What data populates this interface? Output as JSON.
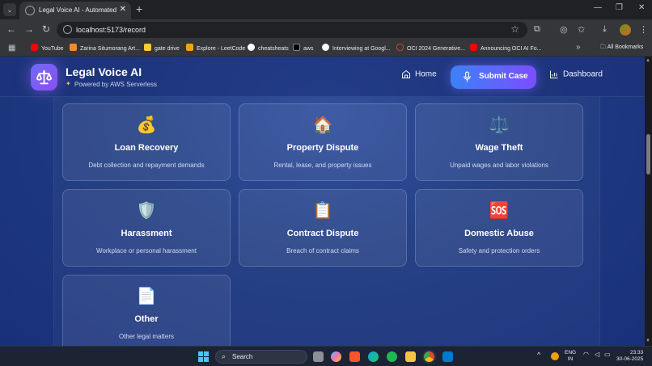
{
  "browser": {
    "tab_title": "Legal Voice AI - Automated Legal",
    "url": "localhost:5173/record",
    "bookmarks": [
      {
        "label": "YouTube",
        "color": "#ff0000"
      },
      {
        "label": "Zarina Situmorang Art...",
        "color": "#f28c28"
      },
      {
        "label": "gate drive",
        "color": "#ffcc33"
      },
      {
        "label": "Explore - LeetCode",
        "color": "#f89f1b"
      },
      {
        "label": "cheatsheats",
        "color": "#ffffff"
      },
      {
        "label": "aws",
        "color": "#232f3e"
      },
      {
        "label": "Interviewing at Googl...",
        "color": "#ffffff"
      },
      {
        "label": "OCI 2024 Generative...",
        "color": "#c74634"
      },
      {
        "label": "Announcing OCI AI Fo...",
        "color": "#ff0000"
      }
    ],
    "all_bookmarks_label": "All Bookmarks"
  },
  "app": {
    "title": "Legal Voice AI",
    "subtitle": "Powered by AWS Serverless",
    "nav": {
      "home": "Home",
      "submit_case": "Submit Case",
      "dashboard": "Dashboard"
    }
  },
  "categories": [
    {
      "title": "Loan Recovery",
      "description": "Debt collection and repayment demands",
      "icon": "💰",
      "icon_name": "money-bag-icon"
    },
    {
      "title": "Property Dispute",
      "description": "Rental, lease, and property issues",
      "icon": "🏠",
      "icon_name": "house-icon"
    },
    {
      "title": "Wage Theft",
      "description": "Unpaid wages and labor violations",
      "icon": "⚖️",
      "icon_name": "scales-icon"
    },
    {
      "title": "Harassment",
      "description": "Workplace or personal harassment",
      "icon": "🛡️",
      "icon_name": "shield-icon"
    },
    {
      "title": "Contract Dispute",
      "description": "Breach of contract claims",
      "icon": "📋",
      "icon_name": "clipboard-icon"
    },
    {
      "title": "Domestic Abuse",
      "description": "Safety and protection orders",
      "icon": "🆘",
      "icon_name": "sos-icon"
    },
    {
      "title": "Other",
      "description": "Other legal matters",
      "icon": "📄",
      "icon_name": "document-icon"
    }
  ],
  "taskbar": {
    "search_label": "Search",
    "language": "ENG",
    "region": "IN",
    "time": "23:33",
    "date": "30-06-2025"
  },
  "colors": {
    "accent_start": "#3b82f6",
    "accent_end": "#7c4dff",
    "logo_gradient_start": "#6f6bf5",
    "logo_gradient_end": "#8b4ff0"
  }
}
